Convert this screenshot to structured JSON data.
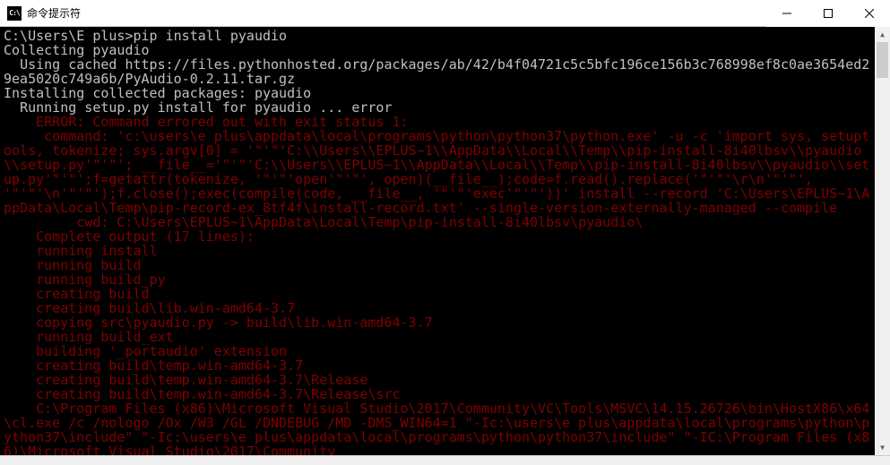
{
  "window": {
    "icon_text": "C:\\",
    "title": "命令提示符"
  },
  "terminal": {
    "lines": [
      {
        "cls": "white",
        "text": ""
      },
      {
        "cls": "white",
        "text": "C:\\Users\\E plus>pip install pyaudio"
      },
      {
        "cls": "white",
        "text": "Collecting pyaudio"
      },
      {
        "cls": "white",
        "text": "  Using cached https://files.pythonhosted.org/packages/ab/42/b4f04721c5c5bfc196ce156b3c768998ef8c0ae3654ed29ea5020c749a6b/PyAudio-0.2.11.tar.gz"
      },
      {
        "cls": "white",
        "text": "Installing collected packages: pyaudio"
      },
      {
        "cls": "white",
        "text": "  Running setup.py install for pyaudio ... error"
      },
      {
        "cls": "red",
        "text": "    ERROR: Command errored out with exit status 1:"
      },
      {
        "cls": "red",
        "text": "     command: 'c:\\users\\e plus\\appdata\\local\\programs\\python\\python37\\python.exe' -u -c 'import sys, setuptools, tokenize; sys.argv[0] = '\"'\"'C:\\\\Users\\\\EPLUS~1\\\\AppData\\\\Local\\\\Temp\\\\pip-install-8i40lbsv\\\\pyaudio\\\\setup.py'\"'\"'; __file__='\"'\"'C:\\\\Users\\\\EPLUS~1\\\\AppData\\\\Local\\\\Temp\\\\pip-install-8i40lbsv\\\\pyaudio\\\\setup.py'\"'\"';f=getattr(tokenize, '\"'\"'open'\"'\"', open)(__file__);code=f.read().replace('\"'\"'\\r\\n'\"'\"', '\"'\"'\\n'\"'\"');f.close();exec(compile(code, __file__, '\"'\"'exec'\"'\"'))' install --record 'C:\\Users\\EPLUS~1\\AppData\\Local\\Temp\\pip-record-ex_8tf4f\\install-record.txt' --single-version-externally-managed --compile"
      },
      {
        "cls": "red",
        "text": "         cwd: C:\\Users\\EPLUS~1\\AppData\\Local\\Temp\\pip-install-8i40lbsv\\pyaudio\\"
      },
      {
        "cls": "red",
        "text": "    Complete output (17 lines):"
      },
      {
        "cls": "red",
        "text": "    running install"
      },
      {
        "cls": "red",
        "text": "    running build"
      },
      {
        "cls": "red",
        "text": "    running build_py"
      },
      {
        "cls": "red",
        "text": "    creating build"
      },
      {
        "cls": "red",
        "text": "    creating build\\lib.win-amd64-3.7"
      },
      {
        "cls": "red",
        "text": "    copying src\\pyaudio.py -> build\\lib.win-amd64-3.7"
      },
      {
        "cls": "red",
        "text": "    running build_ext"
      },
      {
        "cls": "red",
        "text": "    building '_portaudio' extension"
      },
      {
        "cls": "red",
        "text": "    creating build\\temp.win-amd64-3.7"
      },
      {
        "cls": "red",
        "text": "    creating build\\temp.win-amd64-3.7\\Release"
      },
      {
        "cls": "red",
        "text": "    creating build\\temp.win-amd64-3.7\\Release\\src"
      },
      {
        "cls": "red",
        "text": "    C:\\Program Files (x86)\\Microsoft Visual Studio\\2017\\Community\\VC\\Tools\\MSVC\\14.15.26726\\bin\\HostX86\\x64\\cl.exe /c /nologo /Ox /W3 /GL /DNDEBUG /MD -DMS_WIN64=1 \"-Ic:\\users\\e plus\\appdata\\local\\programs\\python\\python37\\include\" \"-Ic:\\users\\e plus\\appdata\\local\\programs\\python\\python37\\include\" \"-IC:\\Program Files (x86)\\Microsoft Visual Studio\\2017\\Community"
      }
    ]
  },
  "statusbar": {
    "text": ""
  }
}
